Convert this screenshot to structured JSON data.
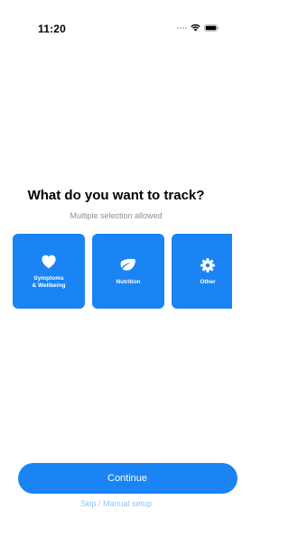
{
  "status_bar": {
    "time": "11:20"
  },
  "header": {
    "title": "What do you want to track?",
    "subtitle": "Multiple selection allowed"
  },
  "options": [
    {
      "label": "Symptoms\n& Wellbeing",
      "icon": "heart-icon"
    },
    {
      "label": "Nutrition",
      "icon": "leaf-icon"
    },
    {
      "label": "Other",
      "icon": "gear-icon"
    }
  ],
  "actions": {
    "continue_label": "Continue",
    "skip_label": "Skip / Manual setup"
  },
  "colors": {
    "accent": "#1a84f4",
    "link": "#8fc3f7",
    "secondary_text": "#8e8e93"
  }
}
